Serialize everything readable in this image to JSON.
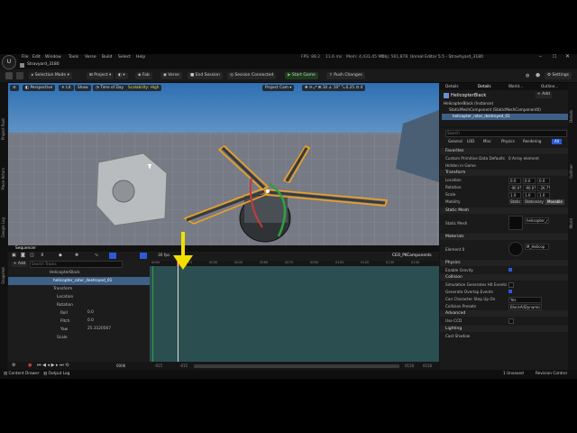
{
  "menu": {
    "items": [
      "File",
      "Edit",
      "Window",
      "Tools",
      "Verse",
      "Build",
      "Select",
      "Help"
    ],
    "perf": "FPS: 88.2",
    "ms": "11.6 ms",
    "mem": "Mem: 4,431.45 Mb",
    "obj": "Obj: 561,878",
    "title": "Unreal Editor 5.5 - Stravhyard_3180"
  },
  "tab": {
    "label": "Stravyard_3180"
  },
  "toolbar": {
    "mode": "Selection Mode",
    "project": "Project",
    "fab": "Fab",
    "verse": "Verse",
    "end_session": "End Session",
    "session": "Session Connected",
    "start_game": "Start Game",
    "push_changes": "Push Changes",
    "settings": "Settings"
  },
  "viewport": {
    "perspective": "Perspective",
    "lit": "Lit",
    "show": "Show",
    "time_of_day": "Time of Day",
    "scalability": "Scalability: High",
    "project_cam": "Project Cam"
  },
  "left_sidebar": [
    "Project Root",
    "Place Actors",
    "Google Log",
    "Snapshot"
  ],
  "outliner": {
    "tabs": [
      "Details",
      "Details",
      "World...",
      "Outline..."
    ],
    "title": "HelicopterBlack",
    "instance": "HelicopterBlack (Instance)",
    "items": [
      "HelicopterBlack",
      "StaticMeshComponent (StaticMeshComponent0)",
      "helicopter_rotor_destroyed_01"
    ],
    "add": "+ Add"
  },
  "details": {
    "search": "Search",
    "filters": [
      "General",
      "LOD",
      "Misc",
      "Physics",
      "Rendering",
      "All"
    ],
    "sections": {
      "favorites": "Favorites",
      "transform": "Transform",
      "static_mesh": "Static Mesh",
      "materials": "Materials",
      "physics": "Physics",
      "collision": "Collision",
      "advanced": "Advanced",
      "lighting": "Lighting"
    },
    "custom_prim": "Custom Primitive Data Defaults",
    "array_elements": "0 Array element",
    "hidden_in_game": "Hidden in Game",
    "location": "Location",
    "loc_vals": [
      "0.0",
      "0.0",
      "0.0"
    ],
    "rotation": "Rotation",
    "rot_vals": [
      "-90.0°",
      "-90.0°",
      "-26.7°"
    ],
    "scale": "Scale",
    "scale_vals": [
      "1.0",
      "1.0",
      "1.0"
    ],
    "mobility": "Mobility",
    "mobility_opts": [
      "Static",
      "Stationary",
      "Movable"
    ],
    "static_mesh_label": "Static Mesh",
    "static_mesh_val": "helicopter_r",
    "element0": "Element 0",
    "element0_val": "M_Helicop",
    "enable_gravity": "Enable Gravity",
    "sim_hit": "Simulation Generates Hit Events",
    "gen_overlap": "Generate Overlap Events",
    "char_step": "Can Character Step Up On",
    "char_step_val": "Yes",
    "coll_presets": "Collision Presets",
    "coll_presets_val": "BlockAllDynamic",
    "use_ccd": "Use CCD",
    "cast_shadow": "Cast Shadow"
  },
  "sequencer": {
    "tab": "Sequencer",
    "add": "+ Add",
    "search": "Search Tracks",
    "fps": "30 fps",
    "seq_name": "CEO_PKComponents",
    "current_frame": "0006",
    "tracks": [
      {
        "label": "HelicopterBlack",
        "value": ""
      },
      {
        "label": "helicopter_rotor_destroyed_01",
        "value": ""
      },
      {
        "label": "Transform",
        "value": ""
      },
      {
        "label": "Location",
        "value": ""
      },
      {
        "label": "Rotation",
        "value": ""
      },
      {
        "label": "Roll",
        "value": "0.0"
      },
      {
        "label": "Pitch",
        "value": "0.0"
      },
      {
        "label": "Yaw",
        "value": "25.3120567"
      },
      {
        "label": "Scale",
        "value": ""
      }
    ],
    "ruler": [
      "0000",
      "0006",
      "0015",
      "0030",
      "0045",
      "0060",
      "0075",
      "0090",
      "0105",
      "0120",
      "0135",
      "0150"
    ],
    "bottom_frames": [
      "-015",
      "-015",
      "0006",
      "0150",
      "0150"
    ]
  },
  "statusbar": {
    "content_drawer": "Content Drawer",
    "output_log": "Output Log",
    "unsaved": "1 Unsaved",
    "revision": "Revision Control"
  },
  "right_sidebar": [
    "Details",
    "Outliner",
    "World"
  ],
  "colors": {
    "accent": "#f0e000",
    "select": "#f0a020",
    "timeline": "#2b4f50",
    "selected_track": "#3e5f86"
  }
}
